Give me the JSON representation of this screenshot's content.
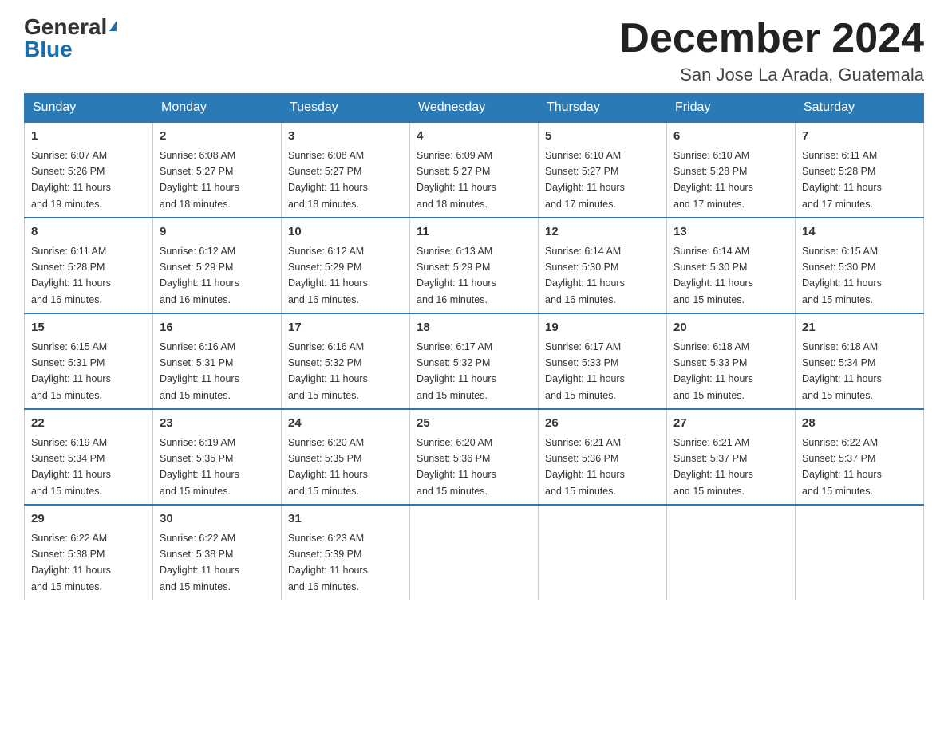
{
  "logo": {
    "general": "General",
    "blue": "Blue",
    "triangle": "▲"
  },
  "title": "December 2024",
  "location": "San Jose La Arada, Guatemala",
  "weekdays": [
    "Sunday",
    "Monday",
    "Tuesday",
    "Wednesday",
    "Thursday",
    "Friday",
    "Saturday"
  ],
  "weeks": [
    [
      {
        "day": "1",
        "sunrise": "6:07 AM",
        "sunset": "5:26 PM",
        "daylight": "11 hours and 19 minutes."
      },
      {
        "day": "2",
        "sunrise": "6:08 AM",
        "sunset": "5:27 PM",
        "daylight": "11 hours and 18 minutes."
      },
      {
        "day": "3",
        "sunrise": "6:08 AM",
        "sunset": "5:27 PM",
        "daylight": "11 hours and 18 minutes."
      },
      {
        "day": "4",
        "sunrise": "6:09 AM",
        "sunset": "5:27 PM",
        "daylight": "11 hours and 18 minutes."
      },
      {
        "day": "5",
        "sunrise": "6:10 AM",
        "sunset": "5:27 PM",
        "daylight": "11 hours and 17 minutes."
      },
      {
        "day": "6",
        "sunrise": "6:10 AM",
        "sunset": "5:28 PM",
        "daylight": "11 hours and 17 minutes."
      },
      {
        "day": "7",
        "sunrise": "6:11 AM",
        "sunset": "5:28 PM",
        "daylight": "11 hours and 17 minutes."
      }
    ],
    [
      {
        "day": "8",
        "sunrise": "6:11 AM",
        "sunset": "5:28 PM",
        "daylight": "11 hours and 16 minutes."
      },
      {
        "day": "9",
        "sunrise": "6:12 AM",
        "sunset": "5:29 PM",
        "daylight": "11 hours and 16 minutes."
      },
      {
        "day": "10",
        "sunrise": "6:12 AM",
        "sunset": "5:29 PM",
        "daylight": "11 hours and 16 minutes."
      },
      {
        "day": "11",
        "sunrise": "6:13 AM",
        "sunset": "5:29 PM",
        "daylight": "11 hours and 16 minutes."
      },
      {
        "day": "12",
        "sunrise": "6:14 AM",
        "sunset": "5:30 PM",
        "daylight": "11 hours and 16 minutes."
      },
      {
        "day": "13",
        "sunrise": "6:14 AM",
        "sunset": "5:30 PM",
        "daylight": "11 hours and 15 minutes."
      },
      {
        "day": "14",
        "sunrise": "6:15 AM",
        "sunset": "5:30 PM",
        "daylight": "11 hours and 15 minutes."
      }
    ],
    [
      {
        "day": "15",
        "sunrise": "6:15 AM",
        "sunset": "5:31 PM",
        "daylight": "11 hours and 15 minutes."
      },
      {
        "day": "16",
        "sunrise": "6:16 AM",
        "sunset": "5:31 PM",
        "daylight": "11 hours and 15 minutes."
      },
      {
        "day": "17",
        "sunrise": "6:16 AM",
        "sunset": "5:32 PM",
        "daylight": "11 hours and 15 minutes."
      },
      {
        "day": "18",
        "sunrise": "6:17 AM",
        "sunset": "5:32 PM",
        "daylight": "11 hours and 15 minutes."
      },
      {
        "day": "19",
        "sunrise": "6:17 AM",
        "sunset": "5:33 PM",
        "daylight": "11 hours and 15 minutes."
      },
      {
        "day": "20",
        "sunrise": "6:18 AM",
        "sunset": "5:33 PM",
        "daylight": "11 hours and 15 minutes."
      },
      {
        "day": "21",
        "sunrise": "6:18 AM",
        "sunset": "5:34 PM",
        "daylight": "11 hours and 15 minutes."
      }
    ],
    [
      {
        "day": "22",
        "sunrise": "6:19 AM",
        "sunset": "5:34 PM",
        "daylight": "11 hours and 15 minutes."
      },
      {
        "day": "23",
        "sunrise": "6:19 AM",
        "sunset": "5:35 PM",
        "daylight": "11 hours and 15 minutes."
      },
      {
        "day": "24",
        "sunrise": "6:20 AM",
        "sunset": "5:35 PM",
        "daylight": "11 hours and 15 minutes."
      },
      {
        "day": "25",
        "sunrise": "6:20 AM",
        "sunset": "5:36 PM",
        "daylight": "11 hours and 15 minutes."
      },
      {
        "day": "26",
        "sunrise": "6:21 AM",
        "sunset": "5:36 PM",
        "daylight": "11 hours and 15 minutes."
      },
      {
        "day": "27",
        "sunrise": "6:21 AM",
        "sunset": "5:37 PM",
        "daylight": "11 hours and 15 minutes."
      },
      {
        "day": "28",
        "sunrise": "6:22 AM",
        "sunset": "5:37 PM",
        "daylight": "11 hours and 15 minutes."
      }
    ],
    [
      {
        "day": "29",
        "sunrise": "6:22 AM",
        "sunset": "5:38 PM",
        "daylight": "11 hours and 15 minutes."
      },
      {
        "day": "30",
        "sunrise": "6:22 AM",
        "sunset": "5:38 PM",
        "daylight": "11 hours and 15 minutes."
      },
      {
        "day": "31",
        "sunrise": "6:23 AM",
        "sunset": "5:39 PM",
        "daylight": "11 hours and 16 minutes."
      },
      null,
      null,
      null,
      null
    ]
  ],
  "labels": {
    "sunrise": "Sunrise:",
    "sunset": "Sunset:",
    "daylight": "Daylight:"
  }
}
